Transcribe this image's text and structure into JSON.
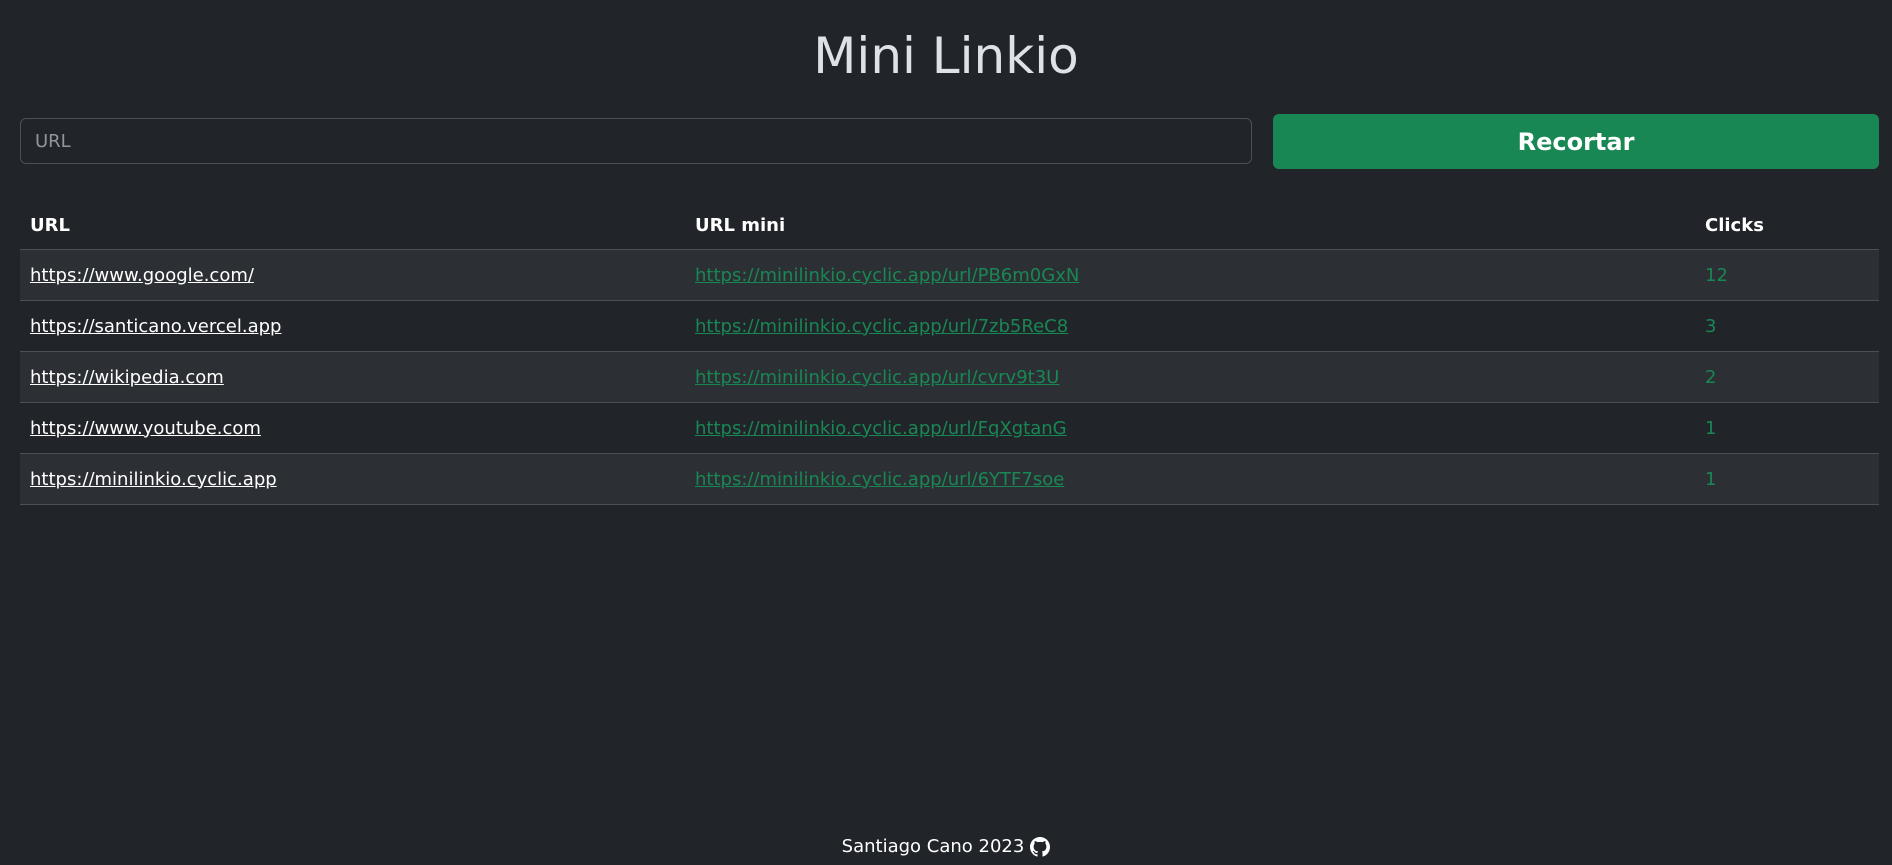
{
  "header": {
    "title": "Mini Linkio"
  },
  "form": {
    "url_placeholder": "URL",
    "url_value": "",
    "submit_label": "Recortar"
  },
  "table": {
    "columns": [
      "URL",
      "URL mini",
      "Clicks"
    ],
    "rows": [
      {
        "url": "https://www.google.com/",
        "mini": "https://minilinkio.cyclic.app/url/PB6m0GxN",
        "clicks": "12"
      },
      {
        "url": "https://santicano.vercel.app",
        "mini": "https://minilinkio.cyclic.app/url/7zb5ReC8",
        "clicks": "3"
      },
      {
        "url": "https://wikipedia.com",
        "mini": "https://minilinkio.cyclic.app/url/cvrv9t3U",
        "clicks": "2"
      },
      {
        "url": "https://www.youtube.com",
        "mini": "https://minilinkio.cyclic.app/url/FqXgtanG",
        "clicks": "1"
      },
      {
        "url": "https://minilinkio.cyclic.app",
        "mini": "https://minilinkio.cyclic.app/url/6YTF7soe",
        "clicks": "1"
      }
    ]
  },
  "footer": {
    "text": "Santiago Cano 2023",
    "icon": "github-icon"
  },
  "colors": {
    "background": "#212529",
    "accent": "#198754",
    "stripe": "#2c3034"
  }
}
